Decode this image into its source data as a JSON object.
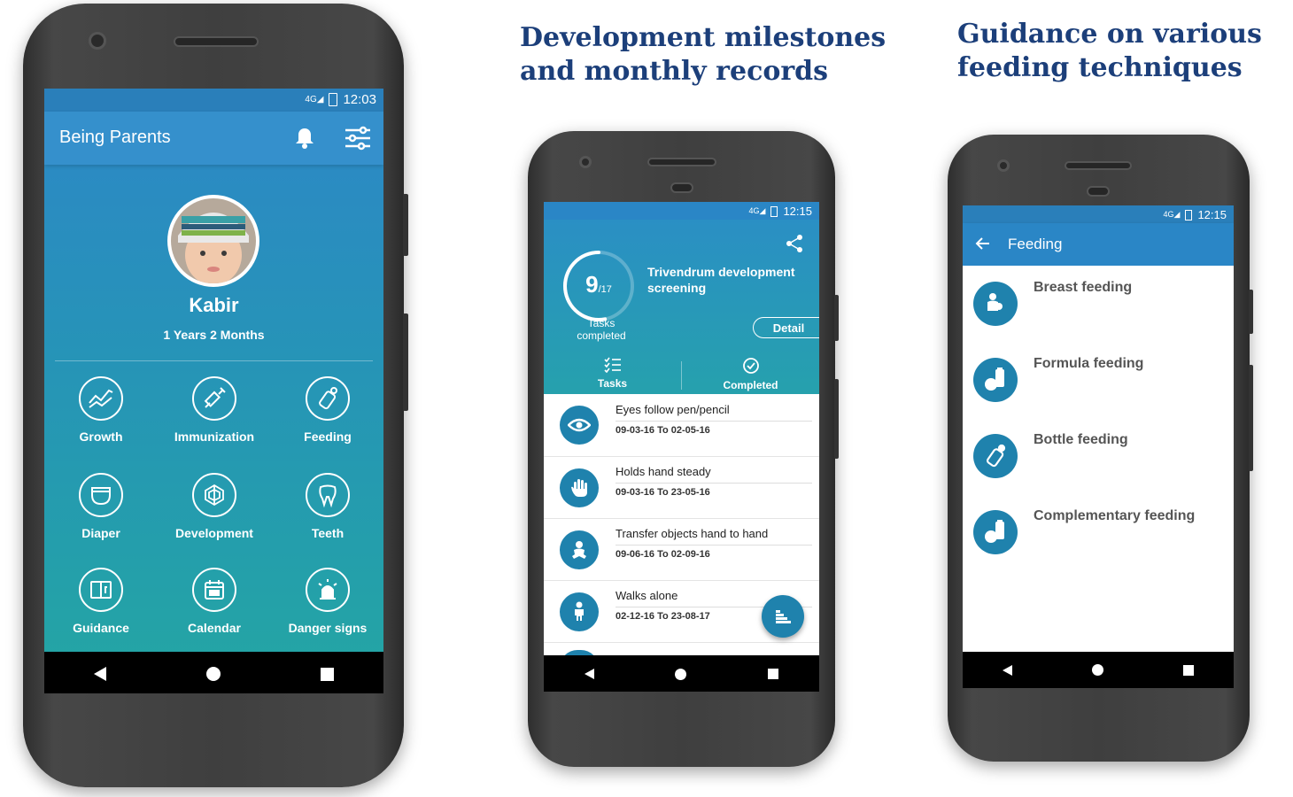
{
  "headings": {
    "middle": [
      "Development milestones",
      "and monthly records"
    ],
    "right": [
      "Guidance on various",
      "feeding techniques"
    ]
  },
  "phone1": {
    "time": "12:03",
    "app_title": "Being Parents",
    "child_name": "Kabir",
    "child_age": "1 Years 2 Months",
    "grid": [
      {
        "label": "Growth",
        "icon": "growth-chart-icon"
      },
      {
        "label": "Immunization",
        "icon": "syringe-icon"
      },
      {
        "label": "Feeding",
        "icon": "bottle-icon"
      },
      {
        "label": "Diaper",
        "icon": "diaper-icon"
      },
      {
        "label": "Development",
        "icon": "development-icon"
      },
      {
        "label": "Teeth",
        "icon": "tooth-icon"
      },
      {
        "label": "Guidance",
        "icon": "book-icon"
      },
      {
        "label": "Calendar",
        "icon": "calendar-icon"
      },
      {
        "label": "Danger signs",
        "icon": "siren-icon"
      }
    ]
  },
  "phone2": {
    "time": "12:15",
    "progress_done": "9",
    "progress_total": "/17",
    "progress_fraction": 0.53,
    "progress_caption": "Tasks completed",
    "screening_title": "Trivendrum development screening",
    "detail_label": "Detail",
    "tab_tasks": "Tasks",
    "tab_completed": "Completed",
    "tasks": [
      {
        "title": "Eyes follow pen/pencil",
        "date": "09-03-16 To 02-05-16",
        "icon": "eye-icon"
      },
      {
        "title": "Holds hand steady",
        "date": "09-03-16 To 23-05-16",
        "icon": "hand-icon"
      },
      {
        "title": "Transfer objects hand to hand",
        "date": "09-06-16 To 02-09-16",
        "icon": "baby-sitting-icon"
      },
      {
        "title": "Walks alone",
        "date": "02-12-16 To 23-08-17",
        "icon": "baby-walking-icon"
      }
    ]
  },
  "phone3": {
    "time": "12:15",
    "title": "Feeding",
    "items": [
      {
        "label": "Breast feeding",
        "icon": "breast-feeding-icon"
      },
      {
        "label": "Formula feeding",
        "icon": "formula-feeding-icon"
      },
      {
        "label": "Bottle feeding",
        "icon": "bottle-feeding-icon"
      },
      {
        "label": "Complementary feeding",
        "icon": "complementary-feeding-icon"
      }
    ]
  },
  "colors": {
    "primary_blue": "#2a86c6",
    "teal": "#23a6a3",
    "icon_blue": "#1f82ad",
    "heading_navy": "#1c3f7a"
  }
}
